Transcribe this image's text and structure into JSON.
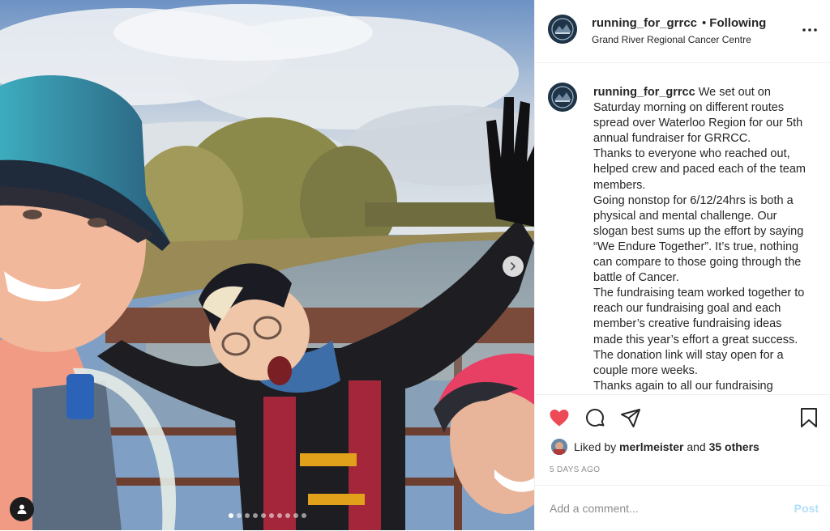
{
  "post": {
    "username": "running_for_grrcc",
    "separator": "•",
    "follow_label": "Following",
    "location": "Grand River Regional Cancer Centre",
    "caption_body": " We set out on Saturday morning on different routes spread over Waterloo Region for our 5th annual fundraiser for GRRCC.\nThanks to everyone who reached out, helped crew and paced each of the team members.\nGoing nonstop for 6/12/24hrs is both a physical and mental challenge. Our slogan best sums up the effort by saying “We Endure Together”. It’s true, nothing can compare to those going through the battle of Cancer.\nThe fundraising team worked together to reach our fundraising goal and each member’s creative fundraising ideas made this year’s effort a great success.\nThe donation link will stay open for a couple more weeks.\nThanks again to all our fundraising",
    "likes": {
      "prefix": "Liked by",
      "user": "merlmeister",
      "and": "and",
      "others": "35 others"
    },
    "timestamp": "5 DAYS AGO",
    "comment": {
      "placeholder": "Add a comment...",
      "value": "",
      "post_label": "Post"
    },
    "carousel": {
      "slide_count": 10,
      "active_index": 0
    }
  },
  "icons": {
    "more": "more-horizontal-icon",
    "like": "heart-filled-icon",
    "comment": "comment-bubble-icon",
    "share": "paper-plane-icon",
    "save": "bookmark-icon",
    "next": "chevron-right-icon",
    "tags": "user-tag-icon"
  },
  "colors": {
    "like_red": "#ed4956",
    "post_disabled_blue": "#b2dffc",
    "muted_text": "#8e8e8e",
    "divider": "#efefef"
  }
}
